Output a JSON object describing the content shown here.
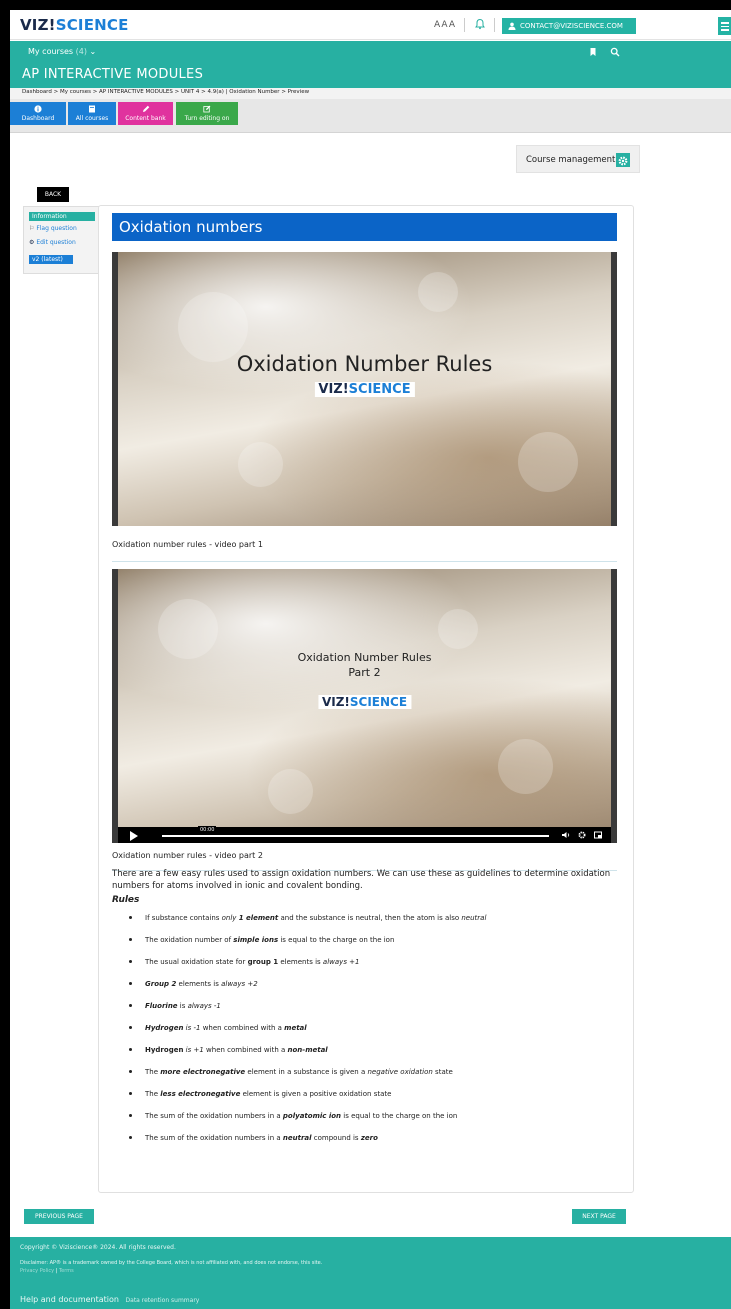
{
  "header": {
    "logo_part1": "VIZ!",
    "logo_part2": "SCIENCE",
    "font_size_toggle": "AAA",
    "contact_label": "CONTACT@VIZISCIENCE.COM"
  },
  "nav": {
    "my_courses": "My courses",
    "my_courses_count": "(4)"
  },
  "course": {
    "title": "AP INTERACTIVE MODULES"
  },
  "breadcrumb": "Dashboard > My courses > AP INTERACTIVE MODULES > UNIT 4 > 4.9(a) | Oxidation Number > Preview",
  "actions": [
    {
      "label": "Dashboard",
      "color": "#1c7fd6"
    },
    {
      "label": "All courses",
      "color": "#1c7fd6"
    },
    {
      "label": "Content bank",
      "color": "#e0329e"
    },
    {
      "label": "Turn editing on",
      "color": "#3aa84a"
    }
  ],
  "course_management": "Course management",
  "back_label": "BACK",
  "question_info": {
    "information": "Information",
    "flag": "Flag question",
    "edit": "Edit question",
    "version": "v2 (latest)"
  },
  "content": {
    "title": "Oxidation numbers",
    "video1": {
      "title": "Oxidation Number Rules",
      "logo_part1": "VIZ!",
      "logo_part2": "SCIENCE",
      "caption": "Oxidation number rules - video part 1"
    },
    "video2": {
      "title_line1": "Oxidation Number Rules",
      "title_line2": "Part 2",
      "logo_part1": "VIZ!",
      "logo_part2": "SCIENCE",
      "time": "00:00",
      "caption": "Oxidation number rules - video part 2"
    },
    "intro": "There are a few easy rules used to assign oxidation numbers. We can use these as guidelines to determine oxidation numbers for atoms involved in ionic and covalent bonding.",
    "rules_title": "Rules",
    "rules": [
      [
        {
          "t": "If substance contains "
        },
        {
          "t": "only ",
          "i": true
        },
        {
          "t": "1 element",
          "b": true,
          "i": true
        },
        {
          "t": " and the substance is neutral, then the atom is also "
        },
        {
          "t": "neutral",
          "i": true
        }
      ],
      [
        {
          "t": "The oxidation number of "
        },
        {
          "t": "simple ions",
          "b": true,
          "i": true
        },
        {
          "t": " is equal to the charge on the ion"
        }
      ],
      [
        {
          "t": "The usual oxidation state for "
        },
        {
          "t": "group 1",
          "b": true
        },
        {
          "t": " elements is "
        },
        {
          "t": "always +1",
          "i": true
        }
      ],
      [
        {
          "t": "Group 2",
          "b": true,
          "i": true
        },
        {
          "t": " elements is "
        },
        {
          "t": "always +2",
          "i": true
        }
      ],
      [
        {
          "t": "Fluorine",
          "b": true,
          "i": true
        },
        {
          "t": " is "
        },
        {
          "t": "always -1",
          "i": true
        }
      ],
      [
        {
          "t": "Hydrogen",
          "b": true,
          "i": true
        },
        {
          "t": " is -1",
          "i": true
        },
        {
          "t": " when combined with a "
        },
        {
          "t": "metal",
          "b": true,
          "i": true
        }
      ],
      [
        {
          "t": "Hydrogen",
          "b": true
        },
        {
          "t": " is +1",
          "i": true
        },
        {
          "t": " when combined with a "
        },
        {
          "t": "non-metal",
          "b": true,
          "i": true
        }
      ],
      [
        {
          "t": "The "
        },
        {
          "t": "more electronegative",
          "b": true,
          "i": true
        },
        {
          "t": " element in a substance is given a "
        },
        {
          "t": "negative oxidation",
          "i": true
        },
        {
          "t": " state"
        }
      ],
      [
        {
          "t": "The "
        },
        {
          "t": "less electronegative",
          "b": true,
          "i": true
        },
        {
          "t": " element is given a positive oxidation state"
        }
      ],
      [
        {
          "t": "The sum of the oxidation numbers in a "
        },
        {
          "t": "polyatomic ion",
          "b": true,
          "i": true
        },
        {
          "t": " is equal to the charge on the ion"
        }
      ],
      [
        {
          "t": "The sum of the oxidation numbers in a "
        },
        {
          "t": "neutral",
          "b": true,
          "i": true
        },
        {
          "t": " compound is "
        },
        {
          "t": "zero",
          "b": true,
          "i": true
        }
      ]
    ]
  },
  "pager": {
    "previous": "PREVIOUS PAGE",
    "next": "NEXT PAGE"
  },
  "footer": {
    "copyright": "Copyright © Viziscience® 2024. All rights reserved.",
    "disclaimer": "Disclaimer: AP® is a trademark owned by the College Board, which is not affiliated with, and does not endorse, this site.",
    "privacy": "Privacy Policy",
    "terms": "Terms",
    "help": "Help and documentation",
    "data_retention": "Data retention summary"
  },
  "colors": {
    "teal": "#27b0a2",
    "blue": "#0b64c7",
    "link": "#1c7fd6"
  }
}
